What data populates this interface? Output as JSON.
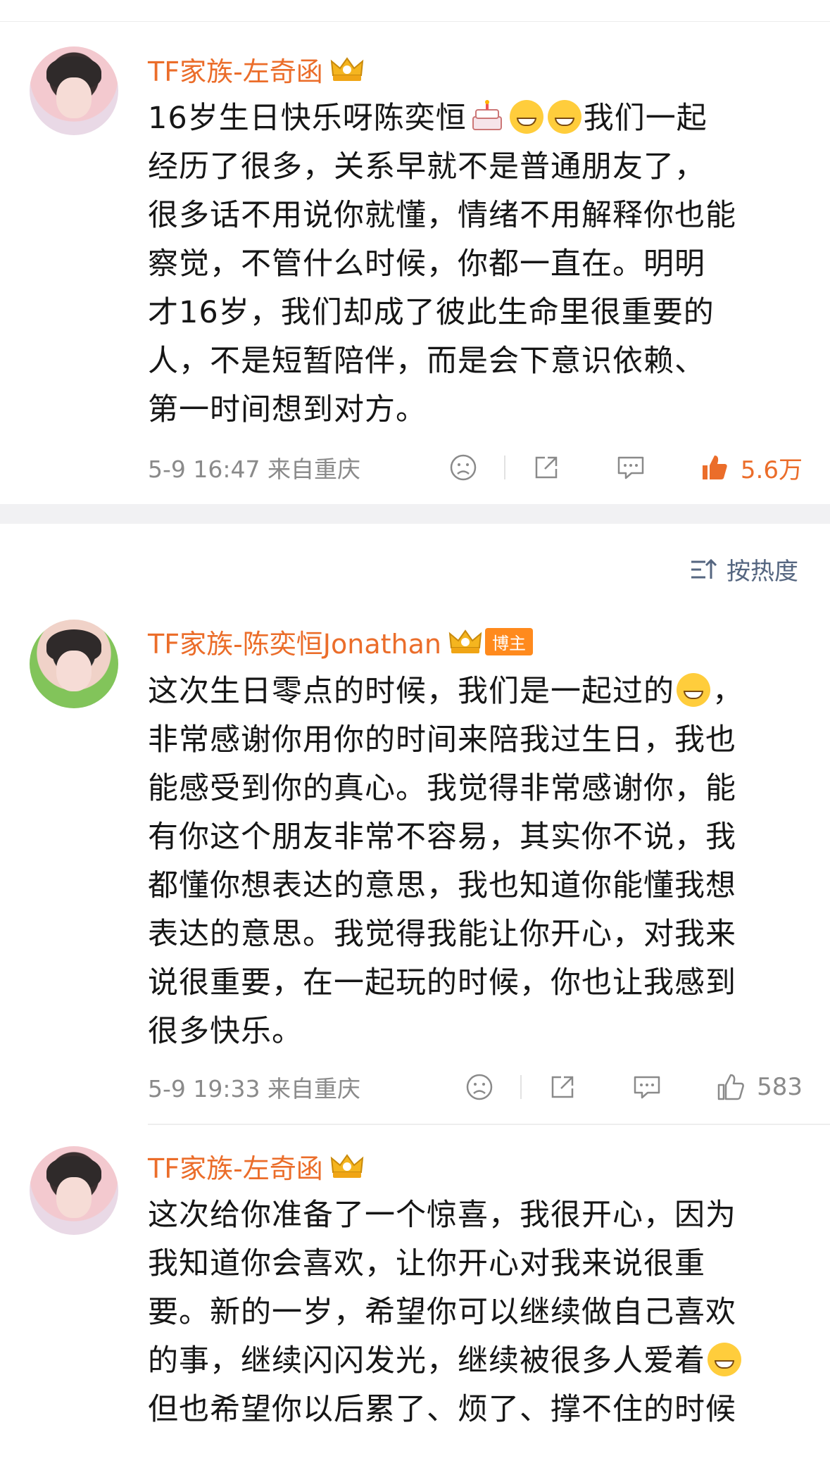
{
  "colors": {
    "name": "#eb6d2a",
    "like_active": "#eb6d2a",
    "meta": "#8a8a8a",
    "sort": "#556680"
  },
  "sort_label": "按热度",
  "comments": [
    {
      "name": "TF家族-左奇函",
      "badge": "",
      "text_1": "16岁生日快乐呀陈奕恒",
      "text_2": "我们一起\n经历了很多，关系早就不是普通朋友了，\n很多话不用说你就懂，情绪不用解释你也能\n察觉，不管什么时候，你都一直在。明明\n才16岁，我们却成了彼此生命里很重要的\n人，不是短暂陪伴，而是会下意识依赖、\n第一时间想到对方。",
      "meta": "5-9 16:47  来自重庆",
      "likes": "5.6万"
    },
    {
      "name": "TF家族-陈奕恒Jonathan",
      "badge": "博主",
      "text_1": "这次生日零点的时候，我们是一起过的",
      "text_2": "，\n非常感谢你用你的时间来陪我过生日，我也\n能感受到你的真心。我觉得非常感谢你，能\n有你这个朋友非常不容易，其实你不说，我\n都懂你想表达的意思，我也知道你能懂我想\n表达的意思。我觉得我能让你开心，对我来\n说很重要，在一起玩的时候，你也让我感到\n很多快乐。",
      "meta": "5-9 19:33  来自重庆",
      "likes": "583"
    },
    {
      "name": "TF家族-左奇函",
      "badge": "",
      "text_1": "这次给你准备了一个惊喜，我很开心，因为\n我知道你会喜欢，让你开心对我来说很重\n要。新的一岁，希望你可以继续做自己喜欢\n的事，继续闪闪发光，继续被很多人爱着",
      "text_2": "\n但也希望你以后累了、烦了、撑不住的时候",
      "meta": "",
      "likes": ""
    }
  ]
}
